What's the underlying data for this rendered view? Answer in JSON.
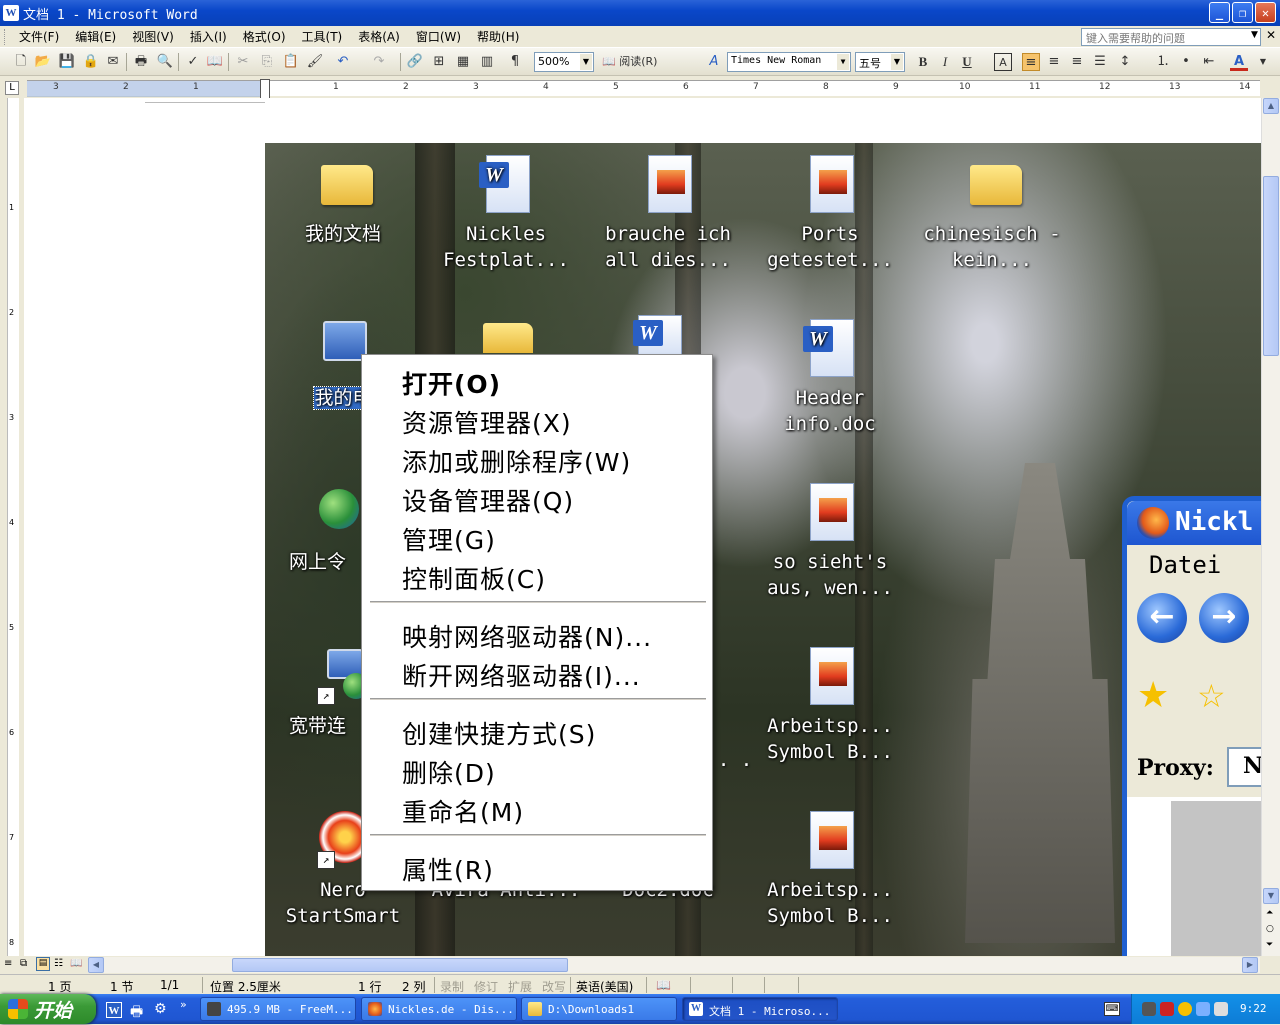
{
  "window": {
    "title": "文档 1 - Microsoft Word",
    "minimize": "_",
    "restore": "❐",
    "close": "✕"
  },
  "menubar": {
    "items": [
      "文件(F)",
      "编辑(E)",
      "视图(V)",
      "插入(I)",
      "格式(O)",
      "工具(T)",
      "表格(A)",
      "窗口(W)",
      "帮助(H)"
    ],
    "help_placeholder": "键入需要帮助的问题"
  },
  "toolbar": {
    "zoom": "500%",
    "read_button": "阅读(R)",
    "font_name": "Times New Roman",
    "font_size": "五号",
    "bold": "B",
    "italic": "I",
    "underline": "U",
    "font_color_label": "A"
  },
  "ruler": {
    "ticks": [
      "3",
      "2",
      "1",
      "1",
      "2",
      "3",
      "4",
      "5",
      "6",
      "7",
      "8",
      "9",
      "10",
      "11",
      "12",
      "13",
      "14"
    ],
    "vticks": [
      "1",
      "2",
      "3",
      "4",
      "5",
      "6",
      "7",
      "8"
    ],
    "tab_selector": "L"
  },
  "desktop": {
    "icons": [
      {
        "label": "我的文档",
        "type": "folder-docs"
      },
      {
        "label": "Nickles Festplat...",
        "type": "word-doc"
      },
      {
        "label": "brauche ich all dies...",
        "type": "image-doc"
      },
      {
        "label": "Ports getestet...",
        "type": "image-doc"
      },
      {
        "label": "chinesisch - kein...",
        "type": "folder"
      },
      {
        "label": "我的电",
        "type": "my-computer",
        "selected": true
      },
      {
        "label": "Header info.doc",
        "type": "word-doc"
      },
      {
        "label": "网上令",
        "type": "network"
      },
      {
        "label": "so sieht's aus, wen...",
        "type": "image-doc"
      },
      {
        "label": "宽带连",
        "type": "broadband"
      },
      {
        "label": "Arbeitsp... Symbol B...",
        "type": "image-doc"
      },
      {
        "label": "Nero StartSmart",
        "type": "nero"
      },
      {
        "label": "Avira Anti...",
        "type": "avira"
      },
      {
        "label": "Doc2.doc",
        "type": "word-doc"
      },
      {
        "label": "Arbeitsp... Symbol B...",
        "type": "image-doc"
      }
    ],
    "partial_text": ". . ."
  },
  "context_menu": {
    "items": [
      {
        "label": "打开(O)",
        "bold": true
      },
      {
        "label": "资源管理器(X)"
      },
      {
        "label": "添加或删除程序(W)"
      },
      {
        "label": "设备管理器(Q)"
      },
      {
        "label": "管理(G)"
      },
      {
        "label": "控制面板(C)"
      },
      {
        "label": "映射网络驱动器(N)..."
      },
      {
        "label": "断开网络驱动器(I)..."
      },
      {
        "label": "创建快捷方式(S)"
      },
      {
        "label": "删除(D)"
      },
      {
        "label": "重命名(M)"
      },
      {
        "label": "属性(R)"
      }
    ]
  },
  "firefox": {
    "title": "Nickl",
    "menu": "Datei B",
    "back": "←",
    "forward": "→",
    "proxy_label": "Proxy:",
    "proxy_value": "No"
  },
  "statusbar": {
    "page": "1 页",
    "section": "1 节",
    "pages": "1/1",
    "position": "位置 2.5厘米",
    "line": "1 行",
    "column": "2 列",
    "rec": "录制",
    "trk": "修订",
    "ext": "扩展",
    "ovr": "改写",
    "language": "英语(美国)"
  },
  "taskbar": {
    "start": "开始",
    "tasks": [
      {
        "label": "495.9 MB - FreeM...",
        "active": false
      },
      {
        "label": "Nickles.de - Dis...",
        "active": false
      },
      {
        "label": "D:\\Downloads1",
        "active": false
      },
      {
        "label": "文档 1 - Microso...",
        "active": true
      }
    ],
    "clock": "9:22"
  },
  "colors": {
    "titlebar": "#0a47c9",
    "taskbar": "#245edb",
    "start": "#3b9a37",
    "selection": "#316ac5"
  }
}
